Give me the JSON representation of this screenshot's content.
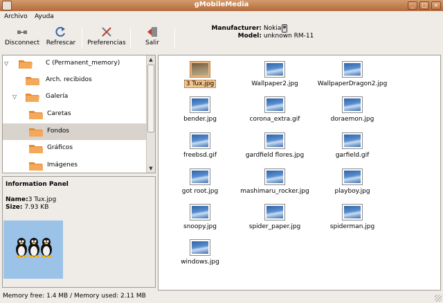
{
  "window": {
    "title": "gMobileMedia"
  },
  "menu": {
    "items": [
      "Archivo",
      "Ayuda"
    ]
  },
  "toolbar": {
    "disconnect": "Disconnect",
    "refresh": "Refrescar",
    "preferences": "Preferencias",
    "quit": "Salir"
  },
  "device": {
    "manufacturer_label": "Manufacturer:",
    "manufacturer": "Nokia",
    "model_label": "Model:",
    "model": "unknown RM-11"
  },
  "tree": {
    "items": [
      {
        "label": "C (Permanent_memory)",
        "expanded": true
      },
      {
        "label": "Arch. recibidos"
      },
      {
        "label": "Galería",
        "expanded": true
      },
      {
        "label": "Caretas"
      },
      {
        "label": "Fondos",
        "selected": true
      },
      {
        "label": "Gráficos"
      },
      {
        "label": "Imágenes"
      }
    ]
  },
  "info": {
    "heading": "Information Panel",
    "name_label": "Name:",
    "name": "3 Tux.jpg",
    "size_label": "Size:",
    "size": "7.93 KB"
  },
  "files": [
    "3 Tux.jpg",
    "Wallpaper2.jpg",
    "WallpaperDragon2.jpg",
    "bender.jpg",
    "corona_extra.gif",
    "doraemon.jpg",
    "freebsd.gif",
    "gardfield flores.jpg",
    "garfield.gif",
    "got root.jpg",
    "mashimaru_rocker.jpg",
    "playboy.jpg",
    "snoopy.jpg",
    "spider_paper.jpg",
    "spiderman.jpg",
    "windows.jpg"
  ],
  "selected_file": "3 Tux.jpg",
  "status": "Memory free: 1.4 MB / Memory used: 2.11 MB",
  "colors": {
    "titlebar": "#c07a46",
    "folder": "#f0a050",
    "selection": "#f2c48f"
  }
}
